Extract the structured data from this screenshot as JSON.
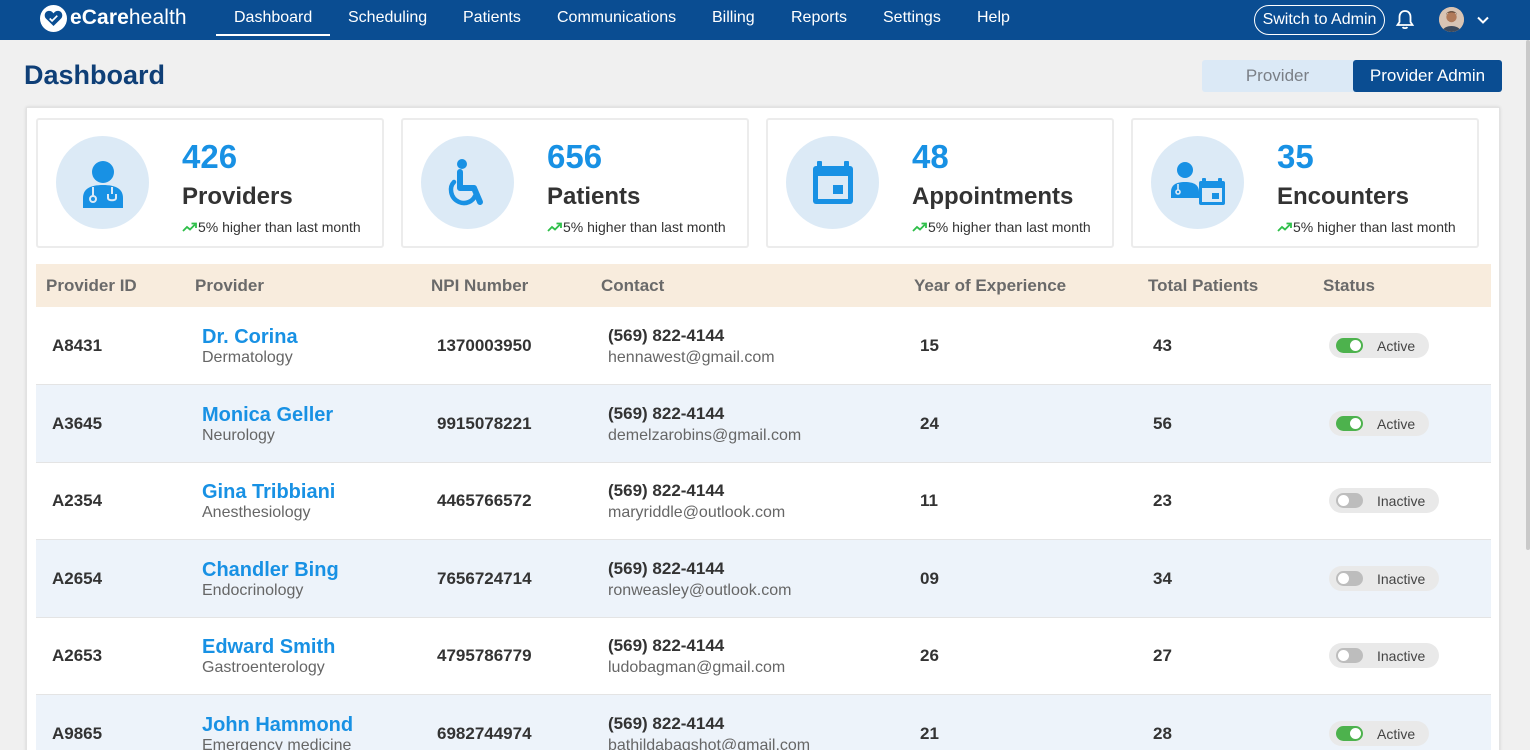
{
  "brand": {
    "name_light": "eCare",
    "name_regular": "health"
  },
  "nav": {
    "items": [
      {
        "label": "Dashboard",
        "active": true
      },
      {
        "label": "Scheduling"
      },
      {
        "label": "Patients"
      },
      {
        "label": "Communications"
      },
      {
        "label": "Billing"
      },
      {
        "label": "Reports"
      },
      {
        "label": "Settings"
      },
      {
        "label": "Help"
      }
    ],
    "switch_admin_label": "Switch to Admin"
  },
  "page": {
    "title": "Dashboard"
  },
  "role_toggle": {
    "provider_label": "Provider",
    "admin_label": "Provider Admin",
    "selected": "Provider Admin"
  },
  "stats": [
    {
      "value": "426",
      "label": "Providers",
      "trend": "5% higher than last month",
      "icon": "provider-icon"
    },
    {
      "value": "656",
      "label": "Patients",
      "trend": "5% higher than last month",
      "icon": "wheelchair-icon"
    },
    {
      "value": "48",
      "label": "Appointments",
      "trend": "5% higher than last month",
      "icon": "calendar-icon"
    },
    {
      "value": "35",
      "label": "Encounters",
      "trend": "5% higher than last month",
      "icon": "encounter-icon"
    }
  ],
  "table": {
    "headers": [
      "Provider ID",
      "Provider",
      "NPI Number",
      "Contact",
      "Year of Experience",
      "Total Patients",
      "Status"
    ],
    "rows": [
      {
        "id": "A8431",
        "name": "Dr. Corina",
        "specialty": "Dermatology",
        "npi": "1370003950",
        "phone": "(569) 822-4144",
        "email": "hennawest@gmail.com",
        "experience": "15",
        "patients": "43",
        "status": "Active"
      },
      {
        "id": "A3645",
        "name": "Monica Geller",
        "specialty": "Neurology",
        "npi": "9915078221",
        "phone": "(569) 822-4144",
        "email": "demelzarobins@gmail.com",
        "experience": "24",
        "patients": "56",
        "status": "Active"
      },
      {
        "id": "A2354",
        "name": "Gina Tribbiani",
        "specialty": "Anesthesiology",
        "npi": "4465766572",
        "phone": "(569) 822-4144",
        "email": "maryriddle@outlook.com",
        "experience": "11",
        "patients": "23",
        "status": "Inactive"
      },
      {
        "id": "A2654",
        "name": "Chandler Bing",
        "specialty": "Endocrinology",
        "npi": "7656724714",
        "phone": "(569) 822-4144",
        "email": "ronweasley@outlook.com",
        "experience": "09",
        "patients": "34",
        "status": "Inactive"
      },
      {
        "id": "A2653",
        "name": "Edward Smith",
        "specialty": "Gastroenterology",
        "npi": "4795786779",
        "phone": "(569) 822-4144",
        "email": "ludobagman@gmail.com",
        "experience": "26",
        "patients": "27",
        "status": "Inactive"
      },
      {
        "id": "A9865",
        "name": "John Hammond",
        "specialty": "Emergency medicine",
        "npi": "6982744974",
        "phone": "(569) 822-4144",
        "email": "bathildabagshot@gmail.com",
        "experience": "21",
        "patients": "28",
        "status": "Active"
      }
    ]
  },
  "colors": {
    "nav_bg": "#0a4d92",
    "accent_blue": "#1891e4",
    "active_green": "#4db24d",
    "header_row": "#f8ecdd",
    "alt_row": "#edf3fa"
  }
}
